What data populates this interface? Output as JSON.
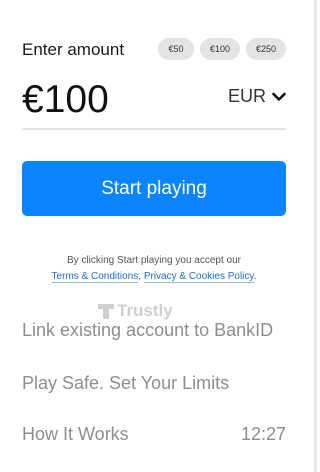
{
  "amount": {
    "title": "Enter amount",
    "presets": [
      "€50",
      "€100",
      "€250"
    ],
    "value": "€100",
    "currency": "EUR"
  },
  "start_button_label": "Start playing",
  "consent": {
    "prefix": "By clicking Start playing you accept our",
    "terms_link": "Terms & Conditions",
    "separator": ",",
    "privacy_link": "Privacy & Cookies Policy",
    "suffix": "."
  },
  "provider": {
    "logo_text": "Trustly",
    "icon": "trustly-logo-icon"
  },
  "links": {
    "bankid": "Link existing account to BankID",
    "play_safe": "Play Safe. Set Your Limits",
    "how_it_works": "How It Works",
    "how_it_works_time": "12:27"
  },
  "colors": {
    "primary": "#0a84ff",
    "chip_bg": "#e4e4e4",
    "link": "#1f6fd0",
    "muted_text": "#8e8e8e"
  }
}
